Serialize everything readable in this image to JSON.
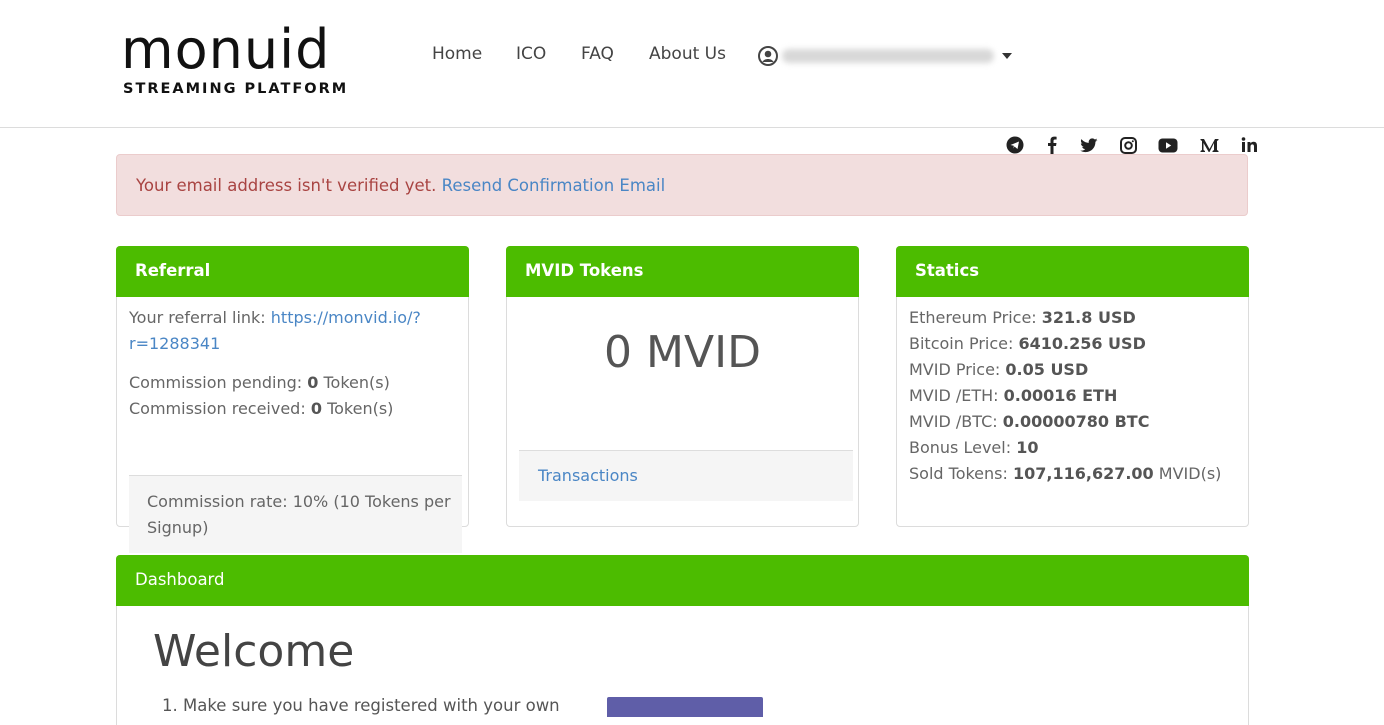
{
  "logo": {
    "word": "monuid",
    "subtitle": "STREAMING PLATFORM"
  },
  "nav": {
    "items": [
      {
        "label": "Home"
      },
      {
        "label": "ICO"
      },
      {
        "label": "FAQ"
      },
      {
        "label": "About Us"
      }
    ],
    "user_icon": "user-circle-icon",
    "email": "",
    "dropdown_icon": "caret-down-icon"
  },
  "social": [
    "telegram-icon",
    "facebook-icon",
    "twitter-icon",
    "instagram-icon",
    "youtube-icon",
    "medium-icon",
    "linkedin-icon"
  ],
  "alert": {
    "message": "Your email address isn't verified yet.",
    "link": "Resend Confirmation Email"
  },
  "referral": {
    "title": "Referral",
    "link_label": "Your referral link:",
    "link_part1": "https://monvid.io/?",
    "link_part2": "r=1288341",
    "pending_label": "Commission pending:",
    "pending_value": "0",
    "pending_unit": "Token(s)",
    "received_label": "Commission received:",
    "received_value": "0",
    "received_unit": "Token(s)",
    "rate_line1": "Commission rate: 10% (10 Tokens per",
    "rate_line2": "Signup)"
  },
  "tokens": {
    "title": "MVID Tokens",
    "balance": "0 MVID",
    "transactions_link": "Transactions"
  },
  "statics": {
    "title": "Statics",
    "rows": [
      {
        "label": "Ethereum Price:",
        "value": "321.8 USD",
        "suffix": ""
      },
      {
        "label": "Bitcoin Price:",
        "value": "6410.256 USD",
        "suffix": ""
      },
      {
        "label": "MVID Price:",
        "value": "0.05 USD",
        "suffix": ""
      },
      {
        "label": "MVID /ETH:",
        "value": "0.00016 ETH",
        "suffix": ""
      },
      {
        "label": "MVID /BTC:",
        "value": "0.00000780 BTC",
        "suffix": ""
      },
      {
        "label": "Bonus Level:",
        "value": "10",
        "suffix": ""
      },
      {
        "label": "Sold Tokens:",
        "value": "107,116,627.00",
        "suffix": "MVID(s)"
      }
    ]
  },
  "dashboard": {
    "title": "Dashboard",
    "welcome": "Welcome",
    "step1": "1. Make sure you have registered with your own"
  },
  "colors": {
    "accent": "#4cbc00",
    "link": "#4a86c5",
    "alert_bg": "#f2dede",
    "alert_text": "#a94442"
  }
}
